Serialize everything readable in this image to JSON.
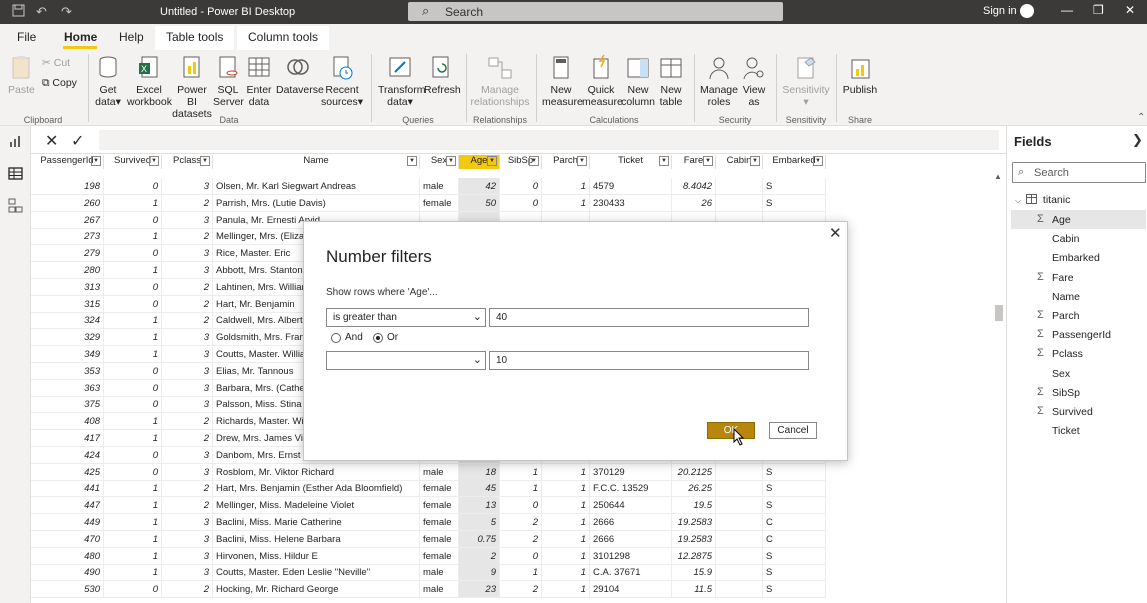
{
  "app": {
    "title": "Untitled - Power BI Desktop",
    "search_placeholder": "Search",
    "sign_in": "Sign in"
  },
  "menu": {
    "file": "File",
    "home": "Home",
    "help": "Help",
    "table_tools": "Table tools",
    "column_tools": "Column tools"
  },
  "ribbon": {
    "clipboard": {
      "paste": "Paste",
      "cut": "Cut",
      "copy": "Copy",
      "group": "Clipboard"
    },
    "data": {
      "get_data": [
        "Get",
        "data"
      ],
      "excel": [
        "Excel",
        "workbook"
      ],
      "pbi": [
        "Power BI",
        "datasets"
      ],
      "sql": [
        "SQL",
        "Server"
      ],
      "enter": [
        "Enter",
        "data"
      ],
      "dataverse": [
        "Dataverse",
        ""
      ],
      "recent": [
        "Recent",
        "sources"
      ],
      "group": "Data"
    },
    "queries": {
      "transform": [
        "Transform",
        "data"
      ],
      "refresh": [
        "Refresh",
        ""
      ],
      "group": "Queries"
    },
    "relationships": {
      "manage": [
        "Manage",
        "relationships"
      ],
      "group": "Relationships"
    },
    "calculations": {
      "new_measure": [
        "New",
        "measure"
      ],
      "quick_measure": [
        "Quick",
        "measure"
      ],
      "new_column": [
        "New",
        "column"
      ],
      "new_table": [
        "New",
        "table"
      ],
      "group": "Calculations"
    },
    "security": {
      "manage_roles": [
        "Manage",
        "roles"
      ],
      "view_as": [
        "View",
        "as"
      ],
      "group": "Security"
    },
    "sensitivity": {
      "sensitivity": [
        "Sensitivity",
        ""
      ],
      "group": "Sensitivity"
    },
    "share": {
      "publish": [
        "Publish",
        ""
      ],
      "group": "Share"
    }
  },
  "table": {
    "columns": [
      "PassengerId",
      "Survived",
      "Pclass",
      "Name",
      "Sex",
      "Age",
      "SibSp",
      "Parch",
      "Ticket",
      "Fare",
      "Cabin",
      "Embarked"
    ],
    "rows": [
      [
        "198",
        "0",
        "3",
        "Olsen, Mr. Karl Siegwart Andreas",
        "male",
        "42",
        "0",
        "1",
        "4579",
        "8.4042",
        "",
        "S"
      ],
      [
        "260",
        "1",
        "2",
        "Parrish, Mrs. (Lutie Davis)",
        "female",
        "50",
        "0",
        "1",
        "230433",
        "26",
        "",
        "S"
      ],
      [
        "267",
        "0",
        "3",
        "Panula, Mr. Ernesti Arvid",
        "",
        "",
        "",
        "",
        "",
        "",
        "",
        ""
      ],
      [
        "273",
        "1",
        "2",
        "Mellinger, Mrs. (Elizab",
        "",
        "",
        "",
        "",
        "",
        "",
        "",
        ""
      ],
      [
        "279",
        "0",
        "3",
        "Rice, Master. Eric",
        "",
        "",
        "",
        "",
        "",
        "",
        "",
        ""
      ],
      [
        "280",
        "1",
        "3",
        "Abbott, Mrs. Stanton (",
        "",
        "",
        "",
        "",
        "",
        "",
        "",
        ""
      ],
      [
        "313",
        "0",
        "2",
        "Lahtinen, Mrs. William",
        "",
        "",
        "",
        "",
        "",
        "",
        "",
        ""
      ],
      [
        "315",
        "0",
        "2",
        "Hart, Mr. Benjamin",
        "",
        "",
        "",
        "",
        "",
        "",
        "",
        ""
      ],
      [
        "324",
        "1",
        "2",
        "Caldwell, Mrs. Albert F",
        "",
        "",
        "",
        "",
        "",
        "",
        "",
        ""
      ],
      [
        "329",
        "1",
        "3",
        "Goldsmith, Mrs. Frank",
        "",
        "",
        "",
        "",
        "",
        "",
        "",
        ""
      ],
      [
        "349",
        "1",
        "3",
        "Coutts, Master. Willian",
        "",
        "",
        "",
        "",
        "",
        "",
        "",
        ""
      ],
      [
        "353",
        "0",
        "3",
        "Elias, Mr. Tannous",
        "",
        "",
        "",
        "",
        "",
        "",
        "",
        ""
      ],
      [
        "363",
        "0",
        "3",
        "Barbara, Mrs. (Catheri",
        "",
        "",
        "",
        "",
        "",
        "",
        "",
        ""
      ],
      [
        "375",
        "0",
        "3",
        "Palsson, Miss. Stina Vi",
        "",
        "",
        "",
        "",
        "",
        "",
        "",
        ""
      ],
      [
        "408",
        "1",
        "2",
        "Richards, Master. Willi",
        "",
        "",
        "",
        "",
        "",
        "",
        "",
        ""
      ],
      [
        "417",
        "1",
        "2",
        "Drew, Mrs. James Vivi",
        "",
        "",
        "",
        "",
        "",
        "",
        "",
        ""
      ],
      [
        "424",
        "0",
        "3",
        "Danbom, Mrs. Ernst G",
        "",
        "",
        "",
        "",
        "",
        "",
        "",
        ""
      ],
      [
        "425",
        "0",
        "3",
        "Rosblom, Mr. Viktor Richard",
        "male",
        "18",
        "1",
        "1",
        "370129",
        "20.2125",
        "",
        "S"
      ],
      [
        "441",
        "1",
        "2",
        "Hart, Mrs. Benjamin (Esther Ada Bloomfield)",
        "female",
        "45",
        "1",
        "1",
        "F.C.C. 13529",
        "26.25",
        "",
        "S"
      ],
      [
        "447",
        "1",
        "2",
        "Mellinger, Miss. Madeleine Violet",
        "female",
        "13",
        "0",
        "1",
        "250644",
        "19.5",
        "",
        "S"
      ],
      [
        "449",
        "1",
        "3",
        "Baclini, Miss. Marie Catherine",
        "female",
        "5",
        "2",
        "1",
        "2666",
        "19.2583",
        "",
        "C"
      ],
      [
        "470",
        "1",
        "3",
        "Baclini, Miss. Helene Barbara",
        "female",
        "0.75",
        "2",
        "1",
        "2666",
        "19.2583",
        "",
        "C"
      ],
      [
        "480",
        "1",
        "3",
        "Hirvonen, Miss. Hildur E",
        "female",
        "2",
        "0",
        "1",
        "3101298",
        "12.2875",
        "",
        "S"
      ],
      [
        "490",
        "1",
        "3",
        "Coutts, Master. Eden Leslie \"Neville\"",
        "male",
        "9",
        "1",
        "1",
        "C.A. 37671",
        "15.9",
        "",
        "S"
      ],
      [
        "530",
        "0",
        "2",
        "Hocking, Mr. Richard George",
        "male",
        "23",
        "2",
        "1",
        "29104",
        "11.5",
        "",
        "S"
      ]
    ]
  },
  "fields": {
    "title": "Fields",
    "search_placeholder": "Search",
    "table_name": "titanic",
    "items": [
      {
        "name": "Age",
        "sigma": true
      },
      {
        "name": "Cabin",
        "sigma": false
      },
      {
        "name": "Embarked",
        "sigma": false
      },
      {
        "name": "Fare",
        "sigma": true
      },
      {
        "name": "Name",
        "sigma": false
      },
      {
        "name": "Parch",
        "sigma": true
      },
      {
        "name": "PassengerId",
        "sigma": true
      },
      {
        "name": "Pclass",
        "sigma": true
      },
      {
        "name": "Sex",
        "sigma": false
      },
      {
        "name": "SibSp",
        "sigma": true
      },
      {
        "name": "Survived",
        "sigma": true
      },
      {
        "name": "Ticket",
        "sigma": false
      }
    ]
  },
  "dialog": {
    "title": "Number filters",
    "description": "Show rows where 'Age'...",
    "condition1_operator": "is greater than",
    "condition1_value": "40",
    "and_label": "And",
    "or_label": "Or",
    "condition2_operator": "",
    "condition2_value": "10",
    "ok": "OK",
    "cancel": "Cancel"
  },
  "colors": {
    "accent": "#f2c811",
    "titlebar": "#3b3a39",
    "ok_button": "#b8860b"
  }
}
